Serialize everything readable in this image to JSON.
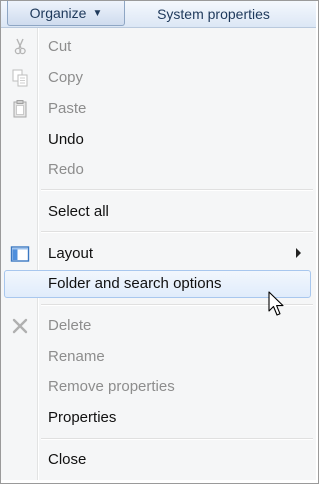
{
  "toolbar": {
    "organize_label": "Organize",
    "system_properties_label": "System properties"
  },
  "menu": {
    "cut": "Cut",
    "copy": "Copy",
    "paste": "Paste",
    "undo": "Undo",
    "redo": "Redo",
    "select_all": "Select all",
    "layout": "Layout",
    "folder_options": "Folder and search options",
    "delete": "Delete",
    "rename": "Rename",
    "remove_properties": "Remove properties",
    "properties": "Properties",
    "close": "Close"
  },
  "icons": {
    "cut": "scissors-icon",
    "copy": "copy-icon",
    "paste": "clipboard-icon",
    "layout": "layout-icon",
    "delete": "delete-x-icon",
    "submenu_arrow": "chevron-right-icon",
    "cursor": "mouse-pointer-icon"
  },
  "colors": {
    "enabled_text": "#111111",
    "disabled_text": "#8d8d8d",
    "hover_border": "#a8c7ee",
    "toolbar_text": "#1e395b"
  }
}
